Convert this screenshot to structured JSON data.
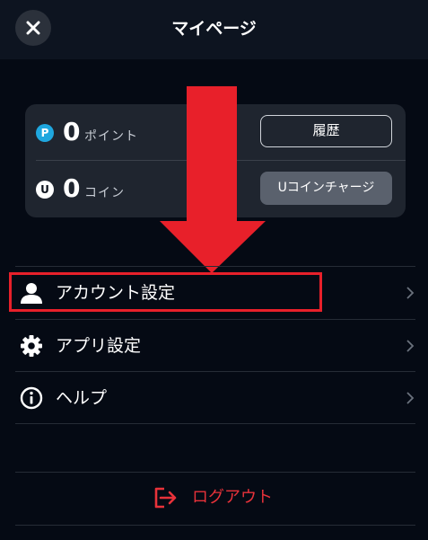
{
  "header": {
    "title": "マイページ"
  },
  "balance": {
    "points": {
      "badge": "P",
      "amount": "0",
      "unit": "ポイント",
      "button_label": "履歴"
    },
    "coins": {
      "badge": "U",
      "amount": "0",
      "unit": "コイン",
      "button_label": "Uコインチャージ"
    }
  },
  "menu": {
    "items": [
      {
        "label": "アカウント設定",
        "icon": "user-icon"
      },
      {
        "label": "アプリ設定",
        "icon": "gear-icon"
      },
      {
        "label": "ヘルプ",
        "icon": "info-icon"
      }
    ]
  },
  "logout": {
    "label": "ログアウト",
    "icon": "logout-icon"
  },
  "colors": {
    "background": "#050a14",
    "card": "#1f252f",
    "accent_red": "#e8202a",
    "point_badge": "#1fa7df"
  }
}
